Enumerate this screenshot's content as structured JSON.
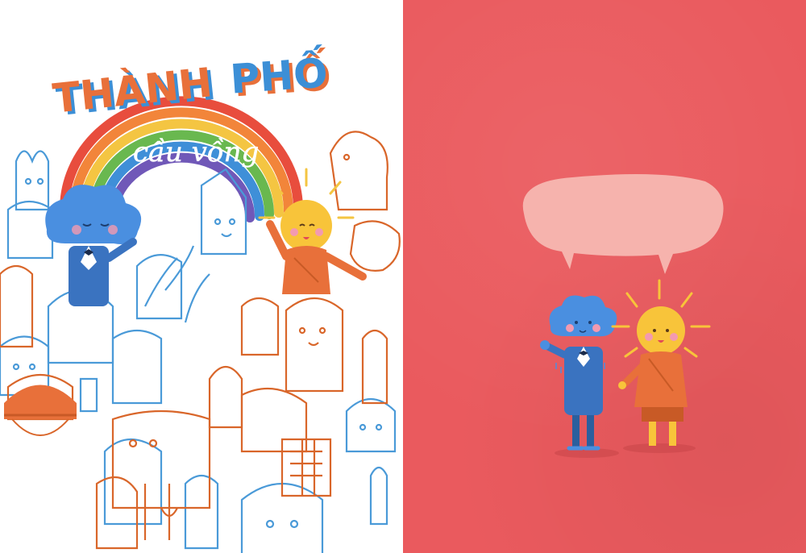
{
  "cover": {
    "title_word_1": "THÀNH",
    "title_word_2": "PHỐ",
    "subtitle": "cầu vồng"
  },
  "colors": {
    "orange": "#e8703a",
    "blue": "#3c8fd6",
    "line_orange": "#d9662a",
    "line_blue": "#4a9ad8",
    "right_page_bg": "#ea5a5e",
    "speech_bubble": "#f6b3ad",
    "cloud": "#4a8fe0",
    "sun": "#f8c43a"
  },
  "characters": [
    {
      "name": "cloud-character",
      "icon": "cloud-icon"
    },
    {
      "name": "sun-character",
      "icon": "sun-icon"
    }
  ]
}
